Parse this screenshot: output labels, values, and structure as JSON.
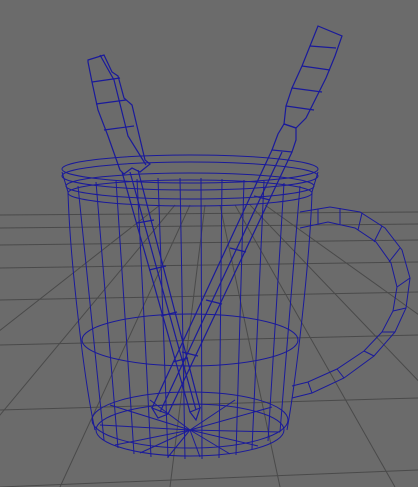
{
  "viewport": {
    "background_color": "#6b6b6b",
    "grid_color": "#4a4a4a",
    "wireframe_color": "#1a1a9a"
  },
  "scene": {
    "objects": [
      "grid-plane-icon",
      "mug-wireframe-icon",
      "mechanical-pencil-wireframe-icon",
      "pen-wireframe-icon"
    ]
  }
}
